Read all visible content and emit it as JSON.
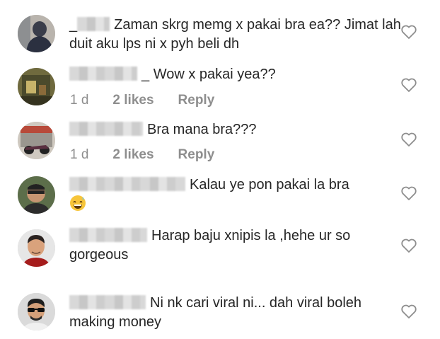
{
  "comments": [
    {
      "text": "Zaman skrg memg x pakai bra ea?? Jimat lah duit aku lps ni x pyh beli dh",
      "name_prefix": "_"
    },
    {
      "text": "Wow x pakai yea??",
      "name_suffix": "_",
      "time": "1 d",
      "likes": "2 likes",
      "reply": "Reply"
    },
    {
      "text": "Bra mana bra???",
      "time": "1 d",
      "likes": "2 likes",
      "reply": "Reply"
    },
    {
      "text": "Kalau ye pon pakai la bra",
      "emoji": "grinning-sweat-emoji"
    },
    {
      "text": "Harap baju xnipis la ,hehe ur so gorgeous"
    },
    {
      "text": "Ni nk cari viral ni... dah viral boleh making money"
    }
  ],
  "colors": {
    "text": "#262626",
    "meta": "#8e8e8e",
    "heart": "#8e8e8e"
  }
}
